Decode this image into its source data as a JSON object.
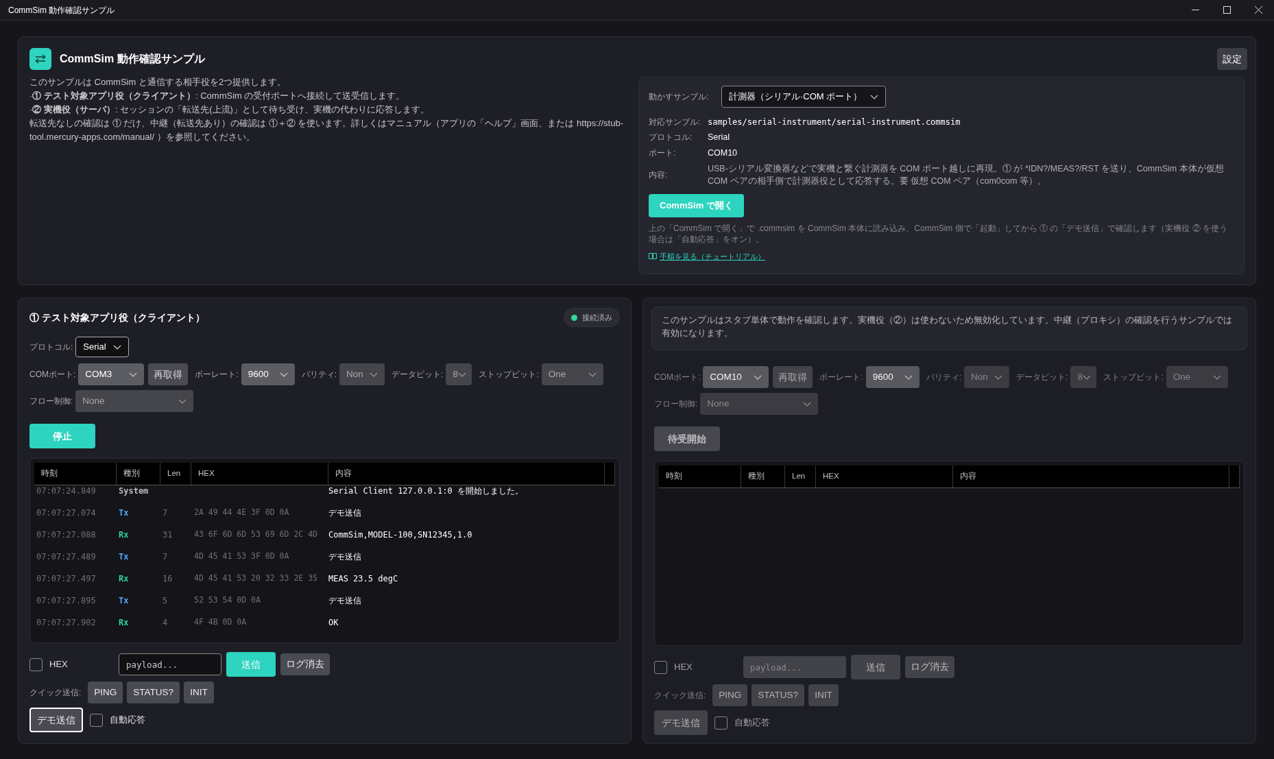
{
  "window": {
    "title": "CommSim 動作確認サンプル"
  },
  "header": {
    "title": "CommSim 動作確認サンプル",
    "settings_button": "設定",
    "description": [
      "このサンプルは CommSim と通信する相手役を2つ提供します。",
      "·**① テスト対象アプリ役（クライアント）**: CommSim の受付ポートへ接続して送受信します。",
      "·**② 実機役（サーバ）**: セッションの「転送先(上流)」として待ち受け、実機の代わりに応答します。",
      "転送先なしの確認は ① だけ、中継（転送先あり）の確認は ①＋② を使います。詳しくはマニュアル（アプリの「ヘルプ」画面、または https://stub-tool.mercury-apps.com/manual/ ）を参照してください。"
    ]
  },
  "sample_panel": {
    "label": "動かすサンプル:",
    "selected_sample": "計測器（シリアル·COM ポート）",
    "fields": [
      {
        "label": "対応サンプル:",
        "value": "samples/serial-instrument/serial-instrument.commsim",
        "kind": "code"
      },
      {
        "label": "プロトコル:",
        "value": "Serial",
        "kind": "text"
      },
      {
        "label": "ポート:",
        "value": "COM10",
        "kind": "text"
      },
      {
        "label": "内容:",
        "value": "USB-シリアル変換器などで実機と繋ぐ計測器を COM ポート越しに再現。① が *IDN?/MEAS?/RST を送り、CommSim 本体が仮想 COM ペアの相手側で計測器役として応答する。要 仮想 COM ペア（com0com 等）。",
        "kind": "note"
      }
    ],
    "open_button": "CommSim で開く",
    "hint": "上の「CommSim で開く」で .commsim を CommSim 本体に読み込み、CommSim 側で「起動」してから ① の「デモ送信」で確認します（実機役 ② を使う場合は「自動応答」をオン）。",
    "tutorial_link": "手順を見る（チュートリアル）"
  },
  "panels": [
    {
      "title": "① テスト対象アプリ役（クライアント）",
      "status": {
        "label": "接続済み",
        "connected": true
      },
      "disabled": false,
      "protocol": {
        "label": "プロトコル:",
        "value": "Serial"
      },
      "settings": [
        {
          "label": "COMポート:",
          "value": "COM3",
          "disabled": false
        },
        {
          "kind": "button",
          "label": "再取得"
        },
        {
          "label": "ボーレート:",
          "value": "9600",
          "disabled": false
        },
        {
          "label": "パリティ:",
          "value": "Non",
          "disabled": true
        },
        {
          "label": "データビット:",
          "value": "8",
          "disabled": true
        },
        {
          "label": "ストップビット:",
          "value": "One",
          "disabled": true
        }
      ],
      "flow_control": {
        "label": "フロー制御:",
        "value": "None",
        "disabled": true
      },
      "start_button": {
        "label": "停止",
        "running": true
      },
      "log": {
        "columns": [
          "時刻",
          "種別",
          "Len",
          "HEX",
          "内容"
        ],
        "rows": [
          {
            "time": "07:07:24.849",
            "type": "System",
            "kind": "system",
            "len": "",
            "hex": "",
            "content": "Serial Client 127.0.0.1:0 を開始しました。"
          },
          {
            "time": "07:07:27.074",
            "type": "Tx",
            "kind": "tx",
            "len": "7",
            "hex": "2A 49 44 4E 3F 0D 0A",
            "content": "デモ送信"
          },
          {
            "time": "07:07:27.088",
            "type": "Rx",
            "kind": "rx",
            "len": "31",
            "hex": "43 6F 6D 6D 53 69 6D 2C 4D",
            "content": "CommSim,MODEL-100,SN12345,1.0"
          },
          {
            "time": "07:07:27.489",
            "type": "Tx",
            "kind": "tx",
            "len": "7",
            "hex": "4D 45 41 53 3F 0D 0A",
            "content": "デモ送信"
          },
          {
            "time": "07:07:27.497",
            "type": "Rx",
            "kind": "rx",
            "len": "16",
            "hex": "4D 45 41 53 20 32 33 2E 35",
            "content": "MEAS 23.5 degC"
          },
          {
            "time": "07:07:27.895",
            "type": "Tx",
            "kind": "tx",
            "len": "5",
            "hex": "52 53 54 0D 0A",
            "content": "デモ送信"
          },
          {
            "time": "07:07:27.902",
            "type": "Rx",
            "kind": "rx",
            "len": "4",
            "hex": "4F 4B 0D 0A",
            "content": "OK"
          }
        ]
      },
      "hex_checkbox": {
        "label": "HEX",
        "checked": false
      },
      "payload": {
        "placeholder": "payload..."
      },
      "send_button": "送信",
      "clear_button": "ログ消去",
      "quick_send": {
        "label": "クイック送信:",
        "buttons": [
          "PING",
          "STATUS?",
          "INIT"
        ]
      },
      "demo_button": {
        "label": "デモ送信",
        "focused": true
      },
      "auto_reply": {
        "label": "自動応答",
        "checked": false
      }
    },
    {
      "notice": "このサンプルはスタブ単体で動作を確認します。実機役（②）は使わないため無効化しています。中継（プロキシ）の確認を行うサンプルでは有効になります。",
      "disabled": true,
      "settings": [
        {
          "label": "COMポート:",
          "value": "COM10",
          "disabled": false
        },
        {
          "kind": "button",
          "label": "再取得"
        },
        {
          "label": "ボーレート:",
          "value": "9600",
          "disabled": false
        },
        {
          "label": "パリティ:",
          "value": "Non",
          "disabled": true
        },
        {
          "label": "データビット:",
          "value": "8",
          "disabled": true
        },
        {
          "label": "ストップビット:",
          "value": "One",
          "disabled": true
        }
      ],
      "flow_control": {
        "label": "フロー制御:",
        "value": "None",
        "disabled": true
      },
      "start_button": {
        "label": "待受開始",
        "running": false
      },
      "log": {
        "columns": [
          "時刻",
          "種別",
          "Len",
          "HEX",
          "内容"
        ]
      },
      "hex_checkbox": {
        "label": "HEX",
        "checked": false
      },
      "payload": {
        "placeholder": "payload..."
      },
      "send_button": "送信",
      "clear_button": "ログ消去",
      "quick_send": {
        "label": "クイック送信:",
        "buttons": [
          "PING",
          "STATUS?",
          "INIT"
        ]
      },
      "demo_button": {
        "label": "デモ送信",
        "focused": false
      },
      "auto_reply": {
        "label": "自動応答",
        "checked": false
      }
    }
  ]
}
